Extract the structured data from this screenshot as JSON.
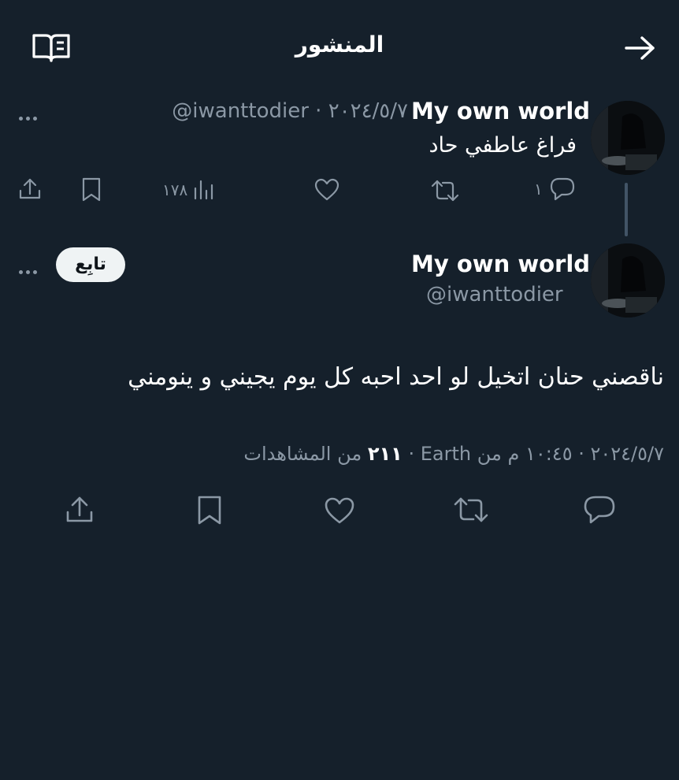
{
  "header": {
    "title": "المنشور"
  },
  "reply_tweet": {
    "author_name": "My own world",
    "meta": "@iwanttodier · ٢٠٢٤/٥/٧",
    "text": "فراغ عاطفي حاد",
    "reply_count": "١",
    "views_count": "١٧٨"
  },
  "main_tweet": {
    "author_name": "My own world",
    "handle": "@iwanttodier",
    "follow_label": "تابِع",
    "text": "ناقصني حنان اتخيل لو احد احبه كل يوم يجيني و ينومني",
    "meta_prefix": "٢٠٢٤/٥/٧ · ١٠:٤٥ م من Earth · ",
    "views_count": "٢١١",
    "views_label": " من المشاهدات"
  },
  "icons": [
    "reading-mode-icon",
    "back-arrow-icon",
    "more-icon",
    "reply-icon",
    "retweet-icon",
    "like-icon",
    "views-icon",
    "bookmark-icon",
    "share-icon"
  ]
}
